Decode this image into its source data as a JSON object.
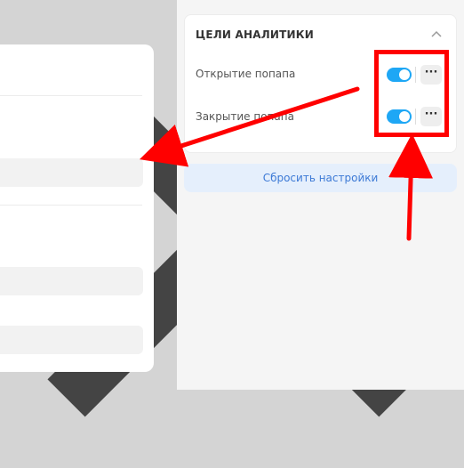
{
  "panel": {
    "title": "ЦЕЛИ АНАЛИТИКИ",
    "goals": [
      {
        "label": "Открытие попапа",
        "enabled": true
      },
      {
        "label": "Закрытие попапа",
        "enabled": true
      }
    ],
    "more_label": "···",
    "reset_label": "Сбросить настройки"
  },
  "colors": {
    "toggle_on": "#1ea7f5",
    "annotation": "#ff0000",
    "reset_text": "#3d7ad6"
  },
  "icons": {
    "close": "close-icon",
    "collapse": "chevron-up-icon"
  }
}
